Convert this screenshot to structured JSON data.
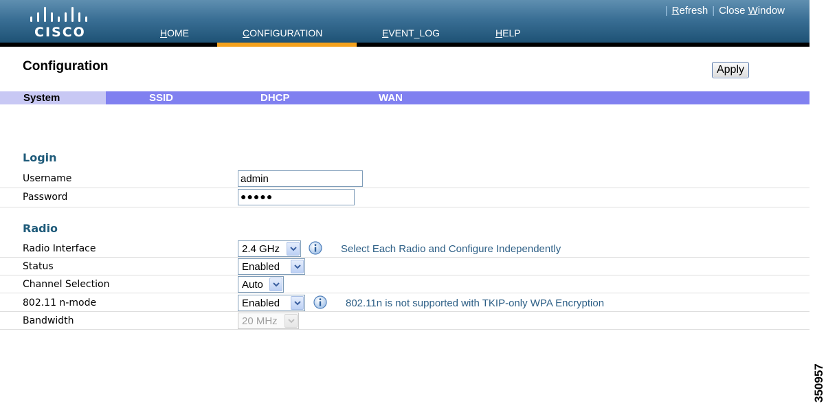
{
  "header": {
    "logo_text": "CISCO",
    "nav": [
      {
        "first": "H",
        "rest": "OME"
      },
      {
        "first": "C",
        "rest": "ONFIGURATION"
      },
      {
        "first": "E",
        "rest": "VENT_LOG"
      },
      {
        "first": "H",
        "rest": "ELP"
      }
    ],
    "active_nav": "CONFIGURATION",
    "util": {
      "refresh_first": "R",
      "refresh_rest": "efresh",
      "close_pre": "Close ",
      "close_first": "W",
      "close_rest": "indow"
    }
  },
  "page": {
    "title": "Configuration",
    "apply_label": "Apply"
  },
  "tabs": [
    "System",
    "SSID",
    "DHCP",
    "WAN"
  ],
  "login": {
    "section_title": "Login",
    "username_label": "Username",
    "username_value": "admin",
    "password_label": "Password",
    "password_value": "●●●●●"
  },
  "radio": {
    "section_title": "Radio",
    "interface_label": "Radio Interface",
    "interface_value": "2.4 GHz",
    "interface_hint": "Select Each Radio and Configure Independently",
    "status_label": "Status",
    "status_value": "Enabled",
    "channel_label": "Channel Selection",
    "channel_value": "Auto",
    "nmode_label": "802.11 n-mode",
    "nmode_value": "Enabled",
    "nmode_hint": "802.11n is not supported with TKIP-only WPA Encryption",
    "bandwidth_label": "Bandwidth",
    "bandwidth_value": "20 MHz"
  },
  "figure_id": "350957",
  "colors": {
    "header_top": "#5f8fb0",
    "header_bottom": "#1e5275",
    "active_tab_marker": "#f4a11c",
    "tab_bar": "#8080f0",
    "tab_active": "#c8c8f4",
    "section_title": "#1f5b7a",
    "hint_text": "#2d5f86"
  }
}
